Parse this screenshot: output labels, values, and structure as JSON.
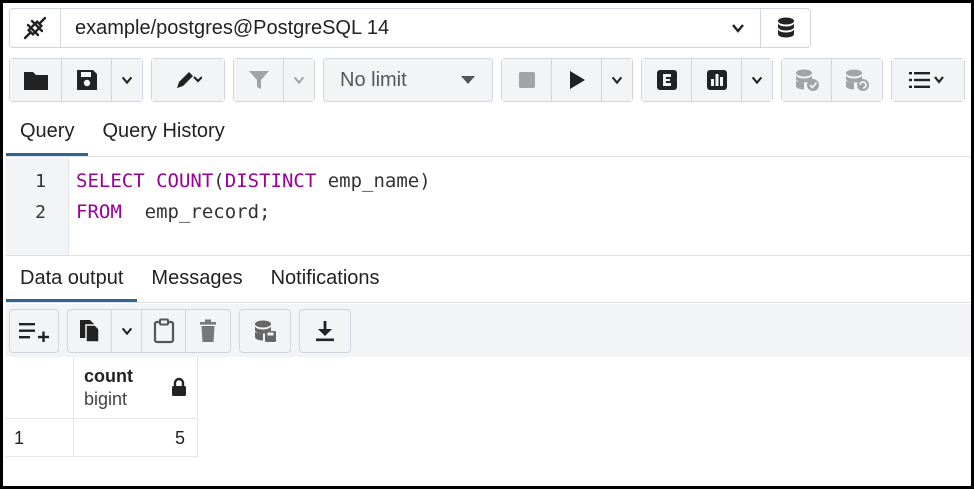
{
  "connection": {
    "label": "example/postgres@PostgreSQL 14",
    "icon": "connection-plug-icon",
    "dropdown_icon": "chevron-down-icon",
    "db_icon": "database-icon"
  },
  "toolbar": {
    "limit_label": "No limit"
  },
  "query_tabs": [
    "Query",
    "Query History"
  ],
  "editor": {
    "line_numbers": [
      "1",
      "2"
    ]
  },
  "output_tabs": [
    "Data output",
    "Messages",
    "Notifications"
  ],
  "grid": {
    "column_name": "count",
    "column_type": "bigint",
    "rows": [
      {
        "row_number": "1",
        "value": "5"
      }
    ]
  },
  "colors": {
    "keyword": "#990096",
    "active_tab_underline": "#326690"
  }
}
